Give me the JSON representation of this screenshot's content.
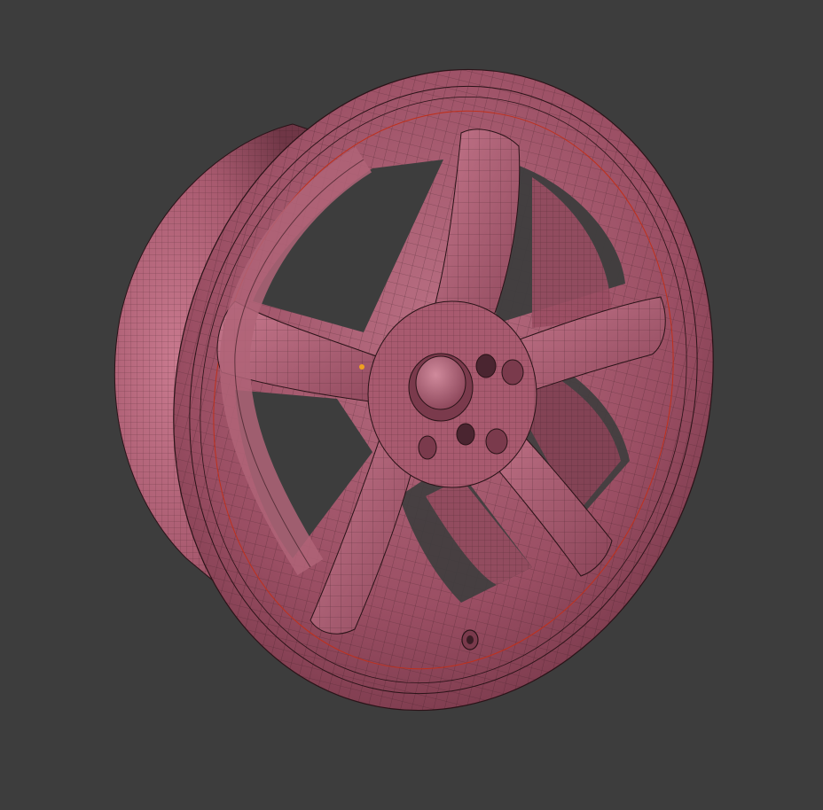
{
  "viewport": {
    "background": "#3d3d3d",
    "shading": "solid",
    "wireframe_overlay": true
  },
  "model": {
    "object": "wheel rim",
    "spoke_count": 5,
    "lug_hole_count": 5,
    "colors": {
      "surface": "#b06478",
      "surface_light": "#c97a8f",
      "surface_dark": "#6f3646",
      "wire": "#2a1318",
      "seam": "#c0301c"
    }
  },
  "origin_marker": {
    "color": "#f0a020"
  }
}
